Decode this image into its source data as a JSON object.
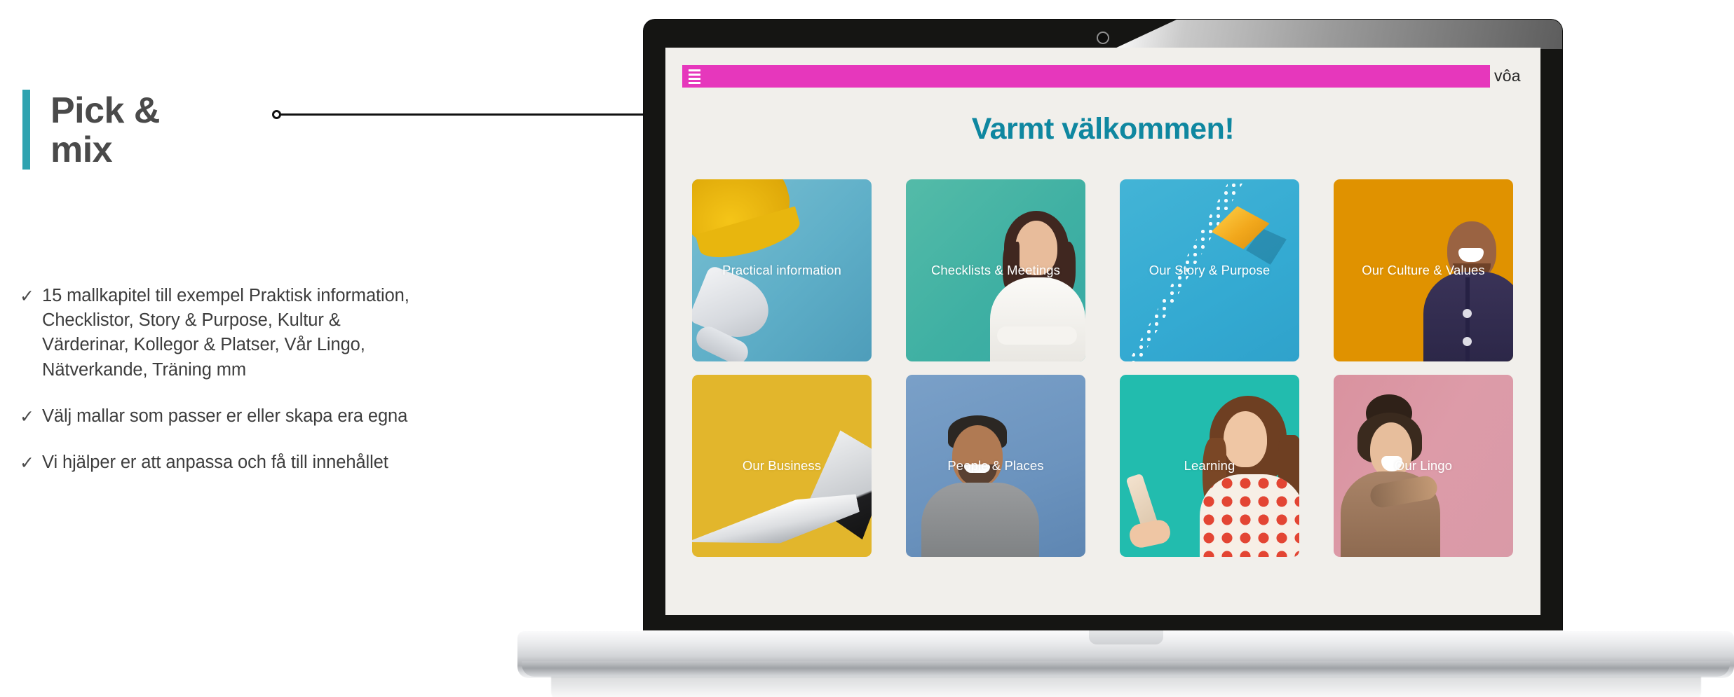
{
  "slide": {
    "title_line1": "Pick &",
    "title_line2": "mix",
    "title": "Pick &\nmix",
    "accent_color": "#2FA3B0",
    "bullets": [
      {
        "marker": "✓",
        "text": "15 mallkapitel till exempel Praktisk information, Checklistor, Story & Purpose, Kultur & Värderinar, Kollegor & Platser, Vår Lingo, Nätverkande, Träning mm"
      },
      {
        "marker": "✓",
        "text": "Välj mallar som passer er eller skapa era egna"
      },
      {
        "marker": "✓",
        "text": "Vi hjälper er att anpassa och få till innehållet"
      }
    ]
  },
  "screen": {
    "background_color": "#F1EFEB",
    "header": {
      "bar_color": "#E637BC",
      "menu_icon": "hamburger-icon",
      "brand": "vôa"
    },
    "page_title": "Varmt välkommen!",
    "page_title_color": "#0F87A0",
    "tiles": [
      {
        "label": "Practical information",
        "color": "#63B2CC",
        "art": "hard-hat-megaphone"
      },
      {
        "label": "Checklists & Meetings",
        "color": "#3FB5A4",
        "art": "woman-arms-crossed"
      },
      {
        "label": "Our Story & Purpose",
        "color": "#37AFD4",
        "art": "paper-boat"
      },
      {
        "label": "Our Culture & Values",
        "color": "#E09200",
        "art": "laughing-man"
      },
      {
        "label": "Our Business",
        "color": "#E2B62C",
        "art": "airplane"
      },
      {
        "label": "People & Places",
        "color": "#6793C0",
        "art": "smiling-man"
      },
      {
        "label": "Learning",
        "color": "#22BCAE",
        "art": "woman-with-phone"
      },
      {
        "label": "Our Lingo",
        "color": "#DD9BA8",
        "art": "pointing-woman"
      }
    ]
  }
}
